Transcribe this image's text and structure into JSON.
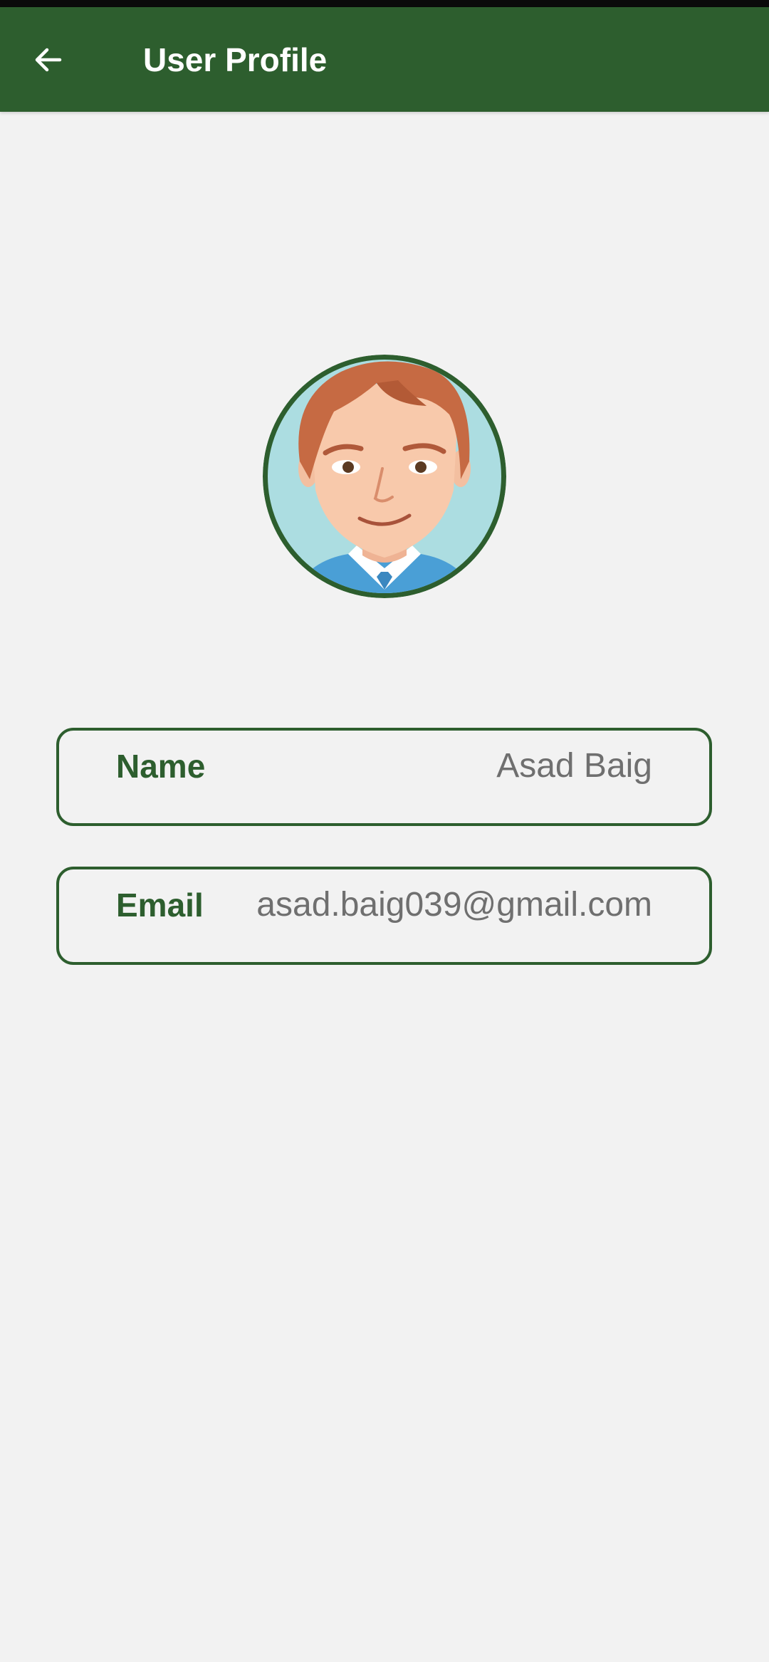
{
  "app_bar": {
    "title": "User Profile",
    "back_icon": "arrow-left-icon",
    "background_color": "#2d5e2e"
  },
  "profile": {
    "avatar_icon": "cartoon-man-avatar",
    "fields": [
      {
        "label": "Name",
        "value": "Asad Baig"
      },
      {
        "label": "Email",
        "value": "asad.baig039@gmail.com"
      }
    ]
  },
  "colors": {
    "accent": "#2d5e2e",
    "background": "#f2f2f2",
    "value_text": "#6f6f6f"
  }
}
